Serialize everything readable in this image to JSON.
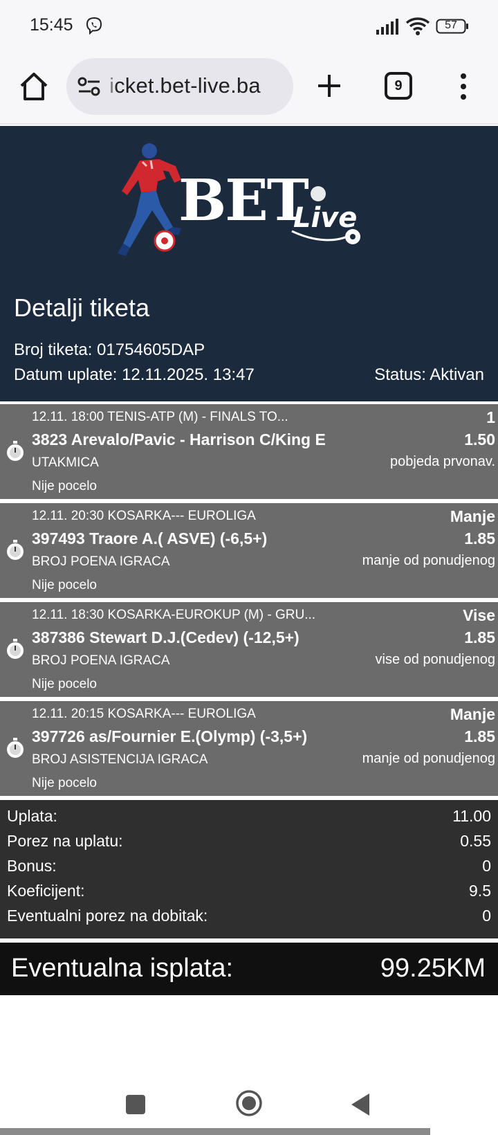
{
  "status_bar": {
    "time": "15:45",
    "battery": "57",
    "icons": [
      "viber-icon",
      "signal-icon",
      "wifi-icon",
      "battery-icon"
    ]
  },
  "browser": {
    "url": "icket.bet-live.ba",
    "tab_count": "9",
    "icons": [
      "home-icon",
      "site-settings-icon",
      "new-tab-plus-icon",
      "tabs-icon",
      "menu-dots-icon"
    ]
  },
  "header": {
    "logo_text_bet": "BET",
    "logo_text_live": "Live",
    "title": "Detalji tiketa",
    "ticket_line": "Broj tiketa: 01754605DAP",
    "date_line": "Datum uplate: 12.11.2025. 13:47",
    "status_line": "Status: Aktivan"
  },
  "bets": [
    {
      "meta": "12.11. 18:00 TENIS-ATP (M) - FINALS TO...",
      "match": "3823 Arevalo/Pavic - Harrison C/King E",
      "market": "UTAKMICA",
      "state": "Nije pocelo",
      "tip": "1",
      "odd": "1.50",
      "tip_desc": "pobjeda prvonav."
    },
    {
      "meta": "12.11. 20:30 KOSARKA--- EUROLIGA",
      "match": "397493 Traore A.( ASVE) (-6,5+)",
      "market": "BROJ POENA IGRACA",
      "state": "Nije pocelo",
      "tip": "Manje",
      "odd": "1.85",
      "tip_desc": "manje od ponudjenog"
    },
    {
      "meta": "12.11. 18:30 KOSARKA-EUROKUP (M) - GRU...",
      "match": "387386 Stewart D.J.(Cedev) (-12,5+)",
      "market": "BROJ POENA IGRACA",
      "state": "Nije pocelo",
      "tip": "Vise",
      "odd": "1.85",
      "tip_desc": "vise od ponudjenog"
    },
    {
      "meta": "12.11. 20:15 KOSARKA--- EUROLIGA",
      "match": "397726 as/Fournier E.(Olymp) (-3,5+)",
      "market": "BROJ ASISTENCIJA IGRACA",
      "state": "Nije pocelo",
      "tip": "Manje",
      "odd": "1.85",
      "tip_desc": "manje od ponudjenog"
    }
  ],
  "summary": [
    {
      "label": "Uplata:",
      "value": "11.00"
    },
    {
      "label": "Porez na uplatu:",
      "value": "0.55"
    },
    {
      "label": "Bonus:",
      "value": "0"
    },
    {
      "label": "Koeficijent:",
      "value": "9.5"
    },
    {
      "label": "Eventualni porez na dobitak:",
      "value": "0"
    }
  ],
  "payout": {
    "label": "Eventualna isplata:",
    "value": "99.25KM"
  },
  "colors": {
    "header_bg": "#1b2a3d",
    "bet_bg": "#6b6b6b",
    "summary_bg": "#2f2f2f",
    "payout_bg": "#101010",
    "logo_red": "#d0282e"
  }
}
